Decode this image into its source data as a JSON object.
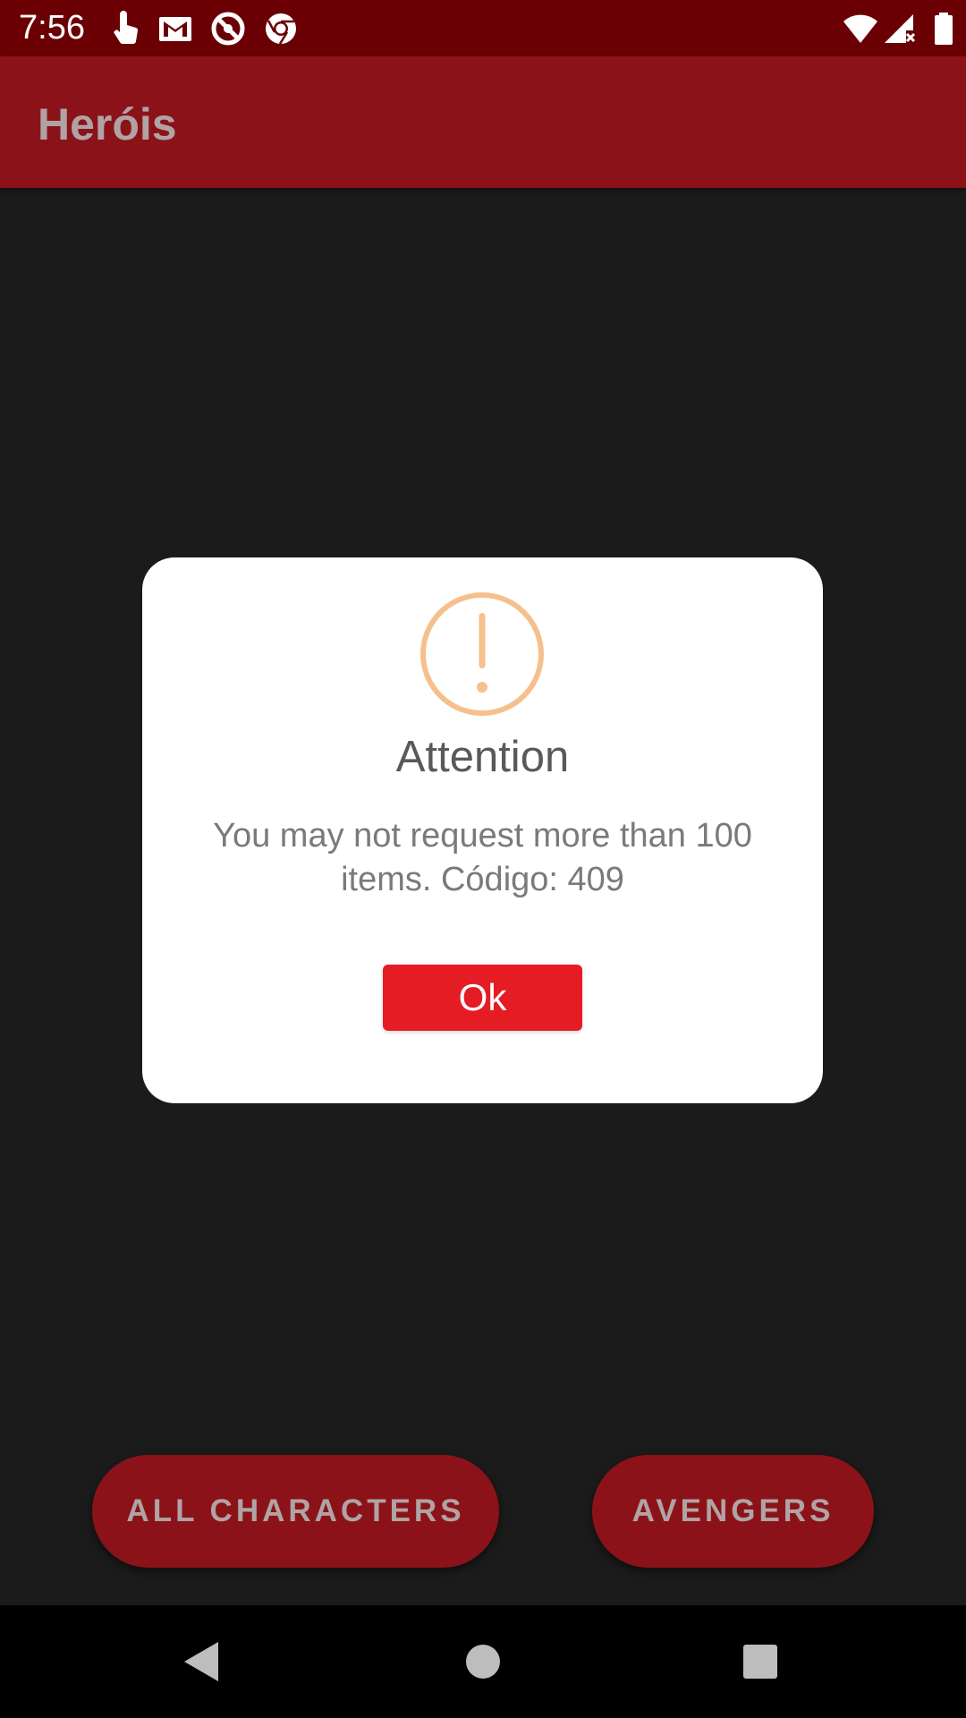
{
  "status_bar": {
    "time": "7:56",
    "icons": [
      "touch-icon",
      "gmail-icon",
      "no-entry-icon",
      "chrome-icon",
      "wifi-icon",
      "signal-icon",
      "battery-icon"
    ]
  },
  "app_bar": {
    "title": "Heróis"
  },
  "dialog": {
    "icon": "warning-icon",
    "title": "Attention",
    "message": "You may not request more than 100 items. Código: 409",
    "ok_label": "Ok"
  },
  "bottom_buttons": {
    "all_characters": "ALL CHARACTERS",
    "avengers": "AVENGERS"
  },
  "nav_bar": {
    "icons": [
      "back-icon",
      "home-icon",
      "recents-icon"
    ]
  },
  "colors": {
    "status_bar": "#6a0003",
    "app_bar": "#8c1219",
    "background": "#1b1b1b",
    "ok_button": "#e61c25",
    "warning_icon": "#f6c08e"
  }
}
